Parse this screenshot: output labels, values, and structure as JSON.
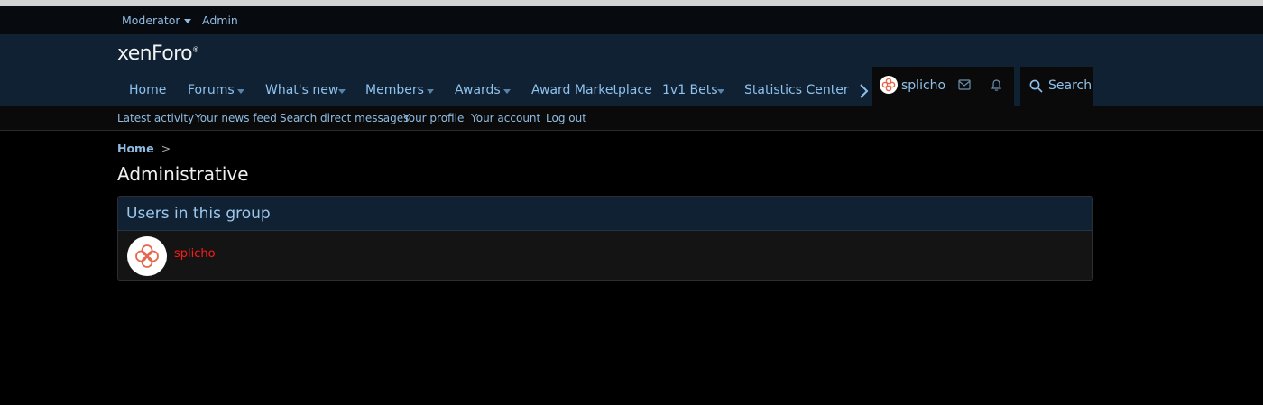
{
  "staffbar": {
    "moderator": "Moderator",
    "admin": "Admin"
  },
  "logo": {
    "text": "xenForo",
    "mark": "®"
  },
  "nav": {
    "items": [
      {
        "label": "Home",
        "dropdown": false
      },
      {
        "label": "Forums",
        "dropdown": true
      },
      {
        "label": "What's new",
        "dropdown": true
      },
      {
        "label": "Members",
        "dropdown": true
      },
      {
        "label": "Awards",
        "dropdown": true
      },
      {
        "label": "Award Marketplace",
        "dropdown": false
      },
      {
        "label": "1v1 Bets",
        "dropdown": true
      },
      {
        "label": "Statistics Center",
        "dropdown": false
      }
    ],
    "more_icon": "chevron-right-icon"
  },
  "account": {
    "username": "splicho",
    "icons": [
      "envelope-icon",
      "bell-icon"
    ]
  },
  "search": {
    "label": "Search",
    "icon": "search-icon"
  },
  "subnav": {
    "links": [
      "Latest activity",
      "Your news feed",
      "Search direct messages",
      "Your profile",
      "Your account",
      "Log out"
    ]
  },
  "breadcrumb": {
    "home": "Home",
    "separator": ">"
  },
  "page": {
    "title": "Administrative"
  },
  "group_block": {
    "title": "Users in this group",
    "members": [
      {
        "name": "splicho",
        "name_color": "#ff1a1a"
      }
    ]
  },
  "colors": {
    "accent": "#8fc1ee",
    "header_bg": "#0f2132",
    "avatar_icon": "#e4684c"
  }
}
